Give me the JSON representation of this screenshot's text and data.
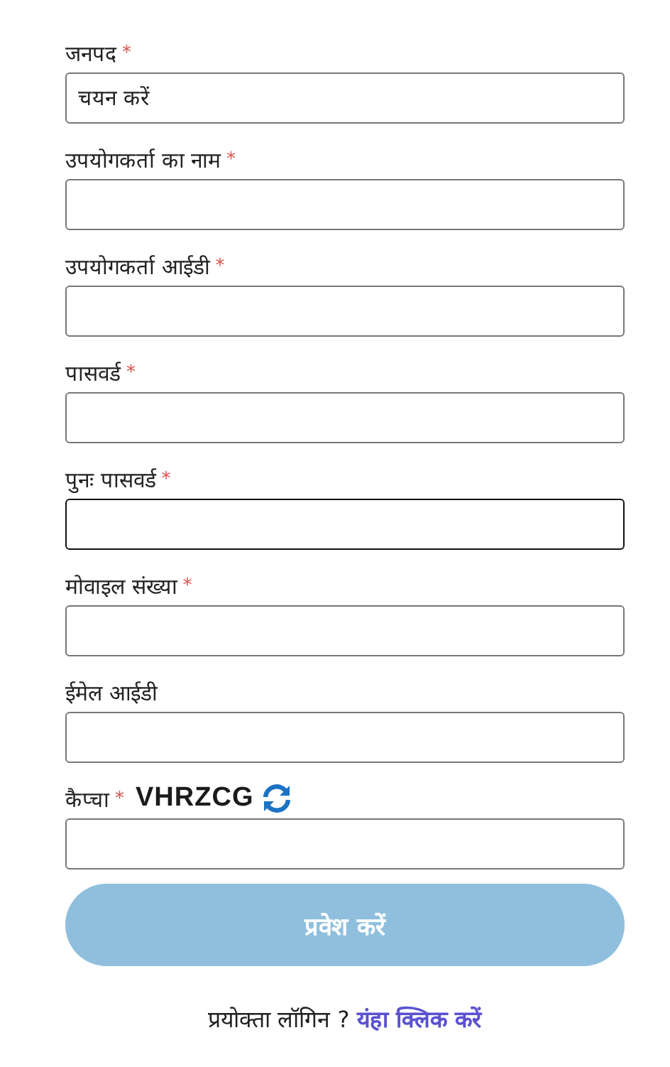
{
  "fields": [
    {
      "label": "जनपद",
      "required_mark": "*",
      "kind": "select",
      "value": "चयन करें",
      "focused": false
    },
    {
      "label": "उपयोगकर्ता का नाम",
      "required_mark": "*",
      "kind": "text",
      "focused": false
    },
    {
      "label": "उपयोगकर्ता आईडी",
      "required_mark": "*",
      "kind": "text",
      "focused": false
    },
    {
      "label": "पासवर्ड",
      "required_mark": "*",
      "kind": "text",
      "focused": false
    },
    {
      "label": "पुनः पासवर्ड",
      "required_mark": "*",
      "kind": "text",
      "focused": true
    },
    {
      "label": "मोवाइल संख्या",
      "required_mark": "*",
      "kind": "text",
      "focused": false
    },
    {
      "label": "ईमेल आईडी",
      "kind": "text",
      "focused": false
    },
    {
      "label": "कैप्चा",
      "required_mark": "*",
      "kind": "captcha",
      "captcha": "VHRZCG",
      "focused": false
    }
  ],
  "submit": {
    "label": "प्रवेश करें",
    "disabled": true
  },
  "login_prompt": {
    "text": "प्रयोक्ता लॉगिन ?",
    "link": "यंहा क्लिक करें"
  }
}
